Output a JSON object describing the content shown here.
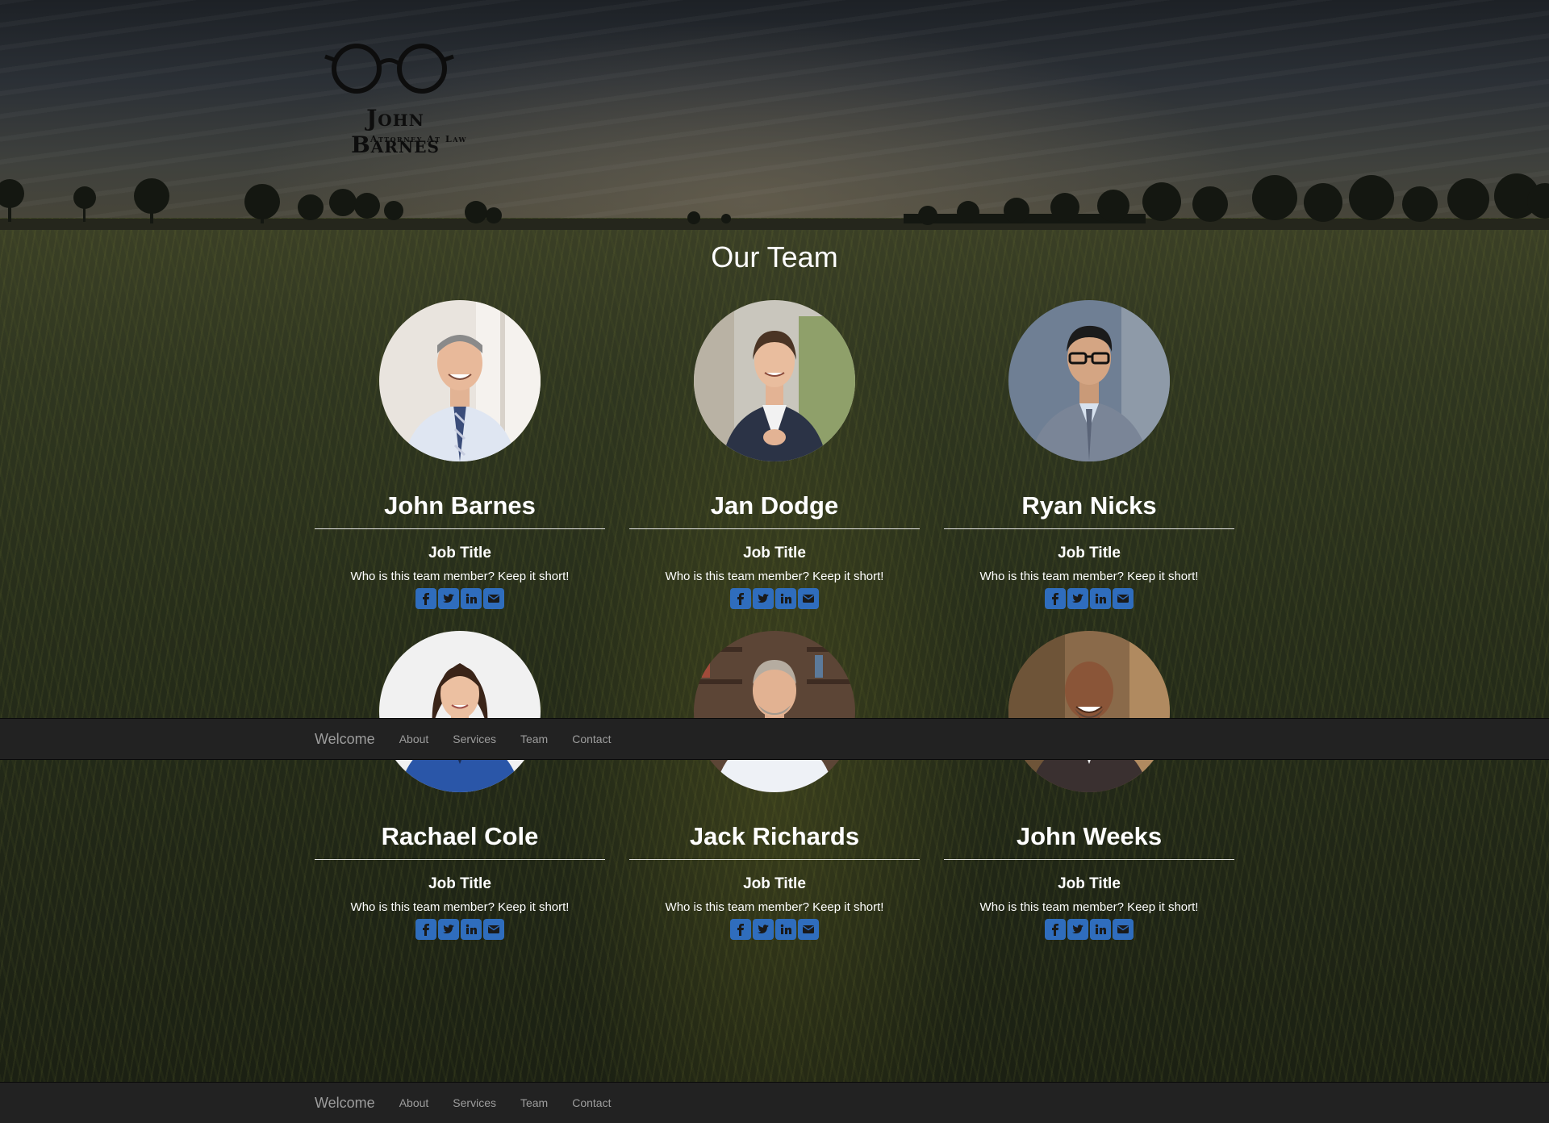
{
  "logo": {
    "name": "John Barnes",
    "tagline": "Attorney At Law"
  },
  "section": {
    "title": "Our Team"
  },
  "team": [
    {
      "name": "John Barnes",
      "job_title": "Job Title",
      "bio": "Who is this team member? Keep it short!"
    },
    {
      "name": "Jan Dodge",
      "job_title": "Job Title",
      "bio": "Who is this team member? Keep it short!"
    },
    {
      "name": "Ryan Nicks",
      "job_title": "Job Title",
      "bio": "Who is this team member? Keep it short!"
    },
    {
      "name": "Rachael Cole",
      "job_title": "Job Title",
      "bio": "Who is this team member? Keep it short!"
    },
    {
      "name": "Jack Richards",
      "job_title": "Job Title",
      "bio": "Who is this team member? Keep it short!"
    },
    {
      "name": "John Weeks",
      "job_title": "Job Title",
      "bio": "Who is this team member? Keep it short!"
    }
  ],
  "social_icons": [
    "facebook-icon",
    "twitter-icon",
    "linkedin-icon",
    "envelope-icon"
  ],
  "navbar": {
    "brand": "Welcome",
    "links": [
      "About",
      "Services",
      "Team",
      "Contact"
    ]
  },
  "colors": {
    "navbar_bg": "#222222",
    "nav_text": "#9d9d9d",
    "social_blue": "#2f6dbd",
    "heading_text": "#ffffff"
  }
}
